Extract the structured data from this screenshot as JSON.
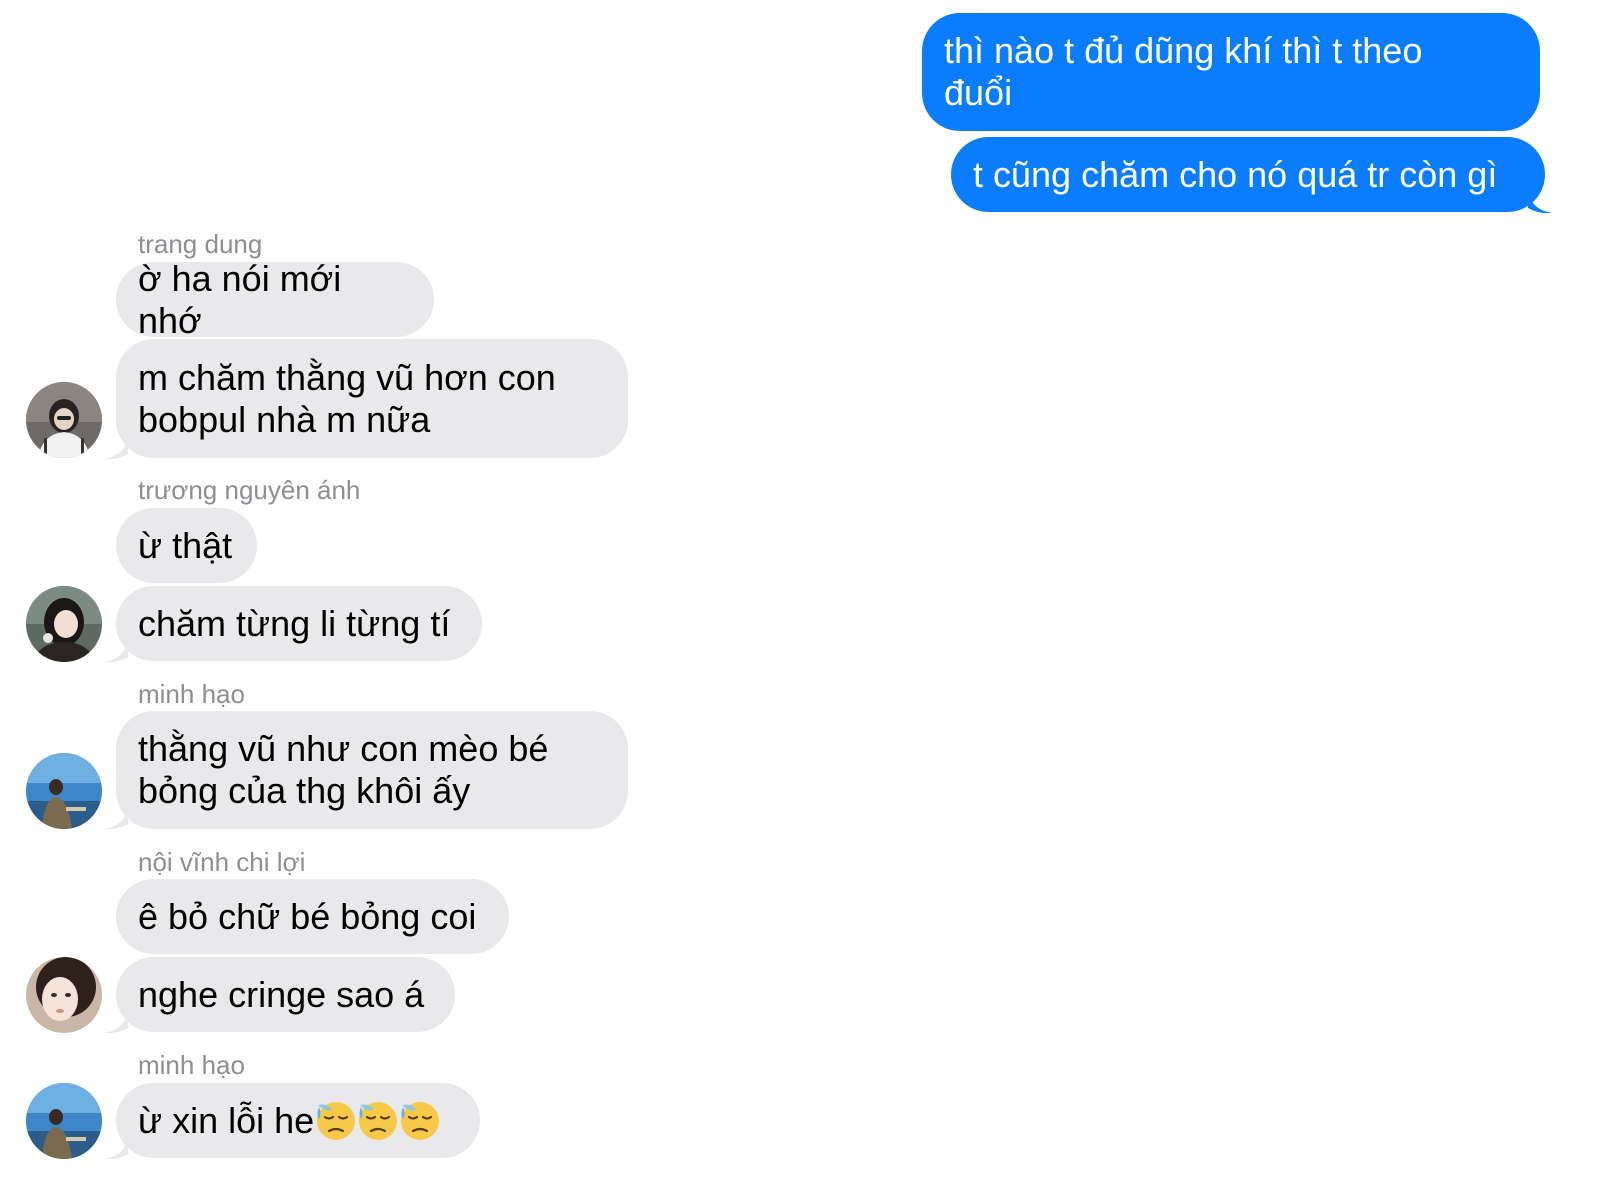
{
  "colors": {
    "outgoing_bubble": "#0a7cff",
    "incoming_bubble": "#e9e9eb",
    "sender_name": "#8e8e93"
  },
  "messages": {
    "out_1": "thì nào t đủ dũng khí thì t theo\nđuổi",
    "out_2": "t cũng chăm cho nó quá tr còn gì",
    "in_1": "ờ ha nói mới nhớ",
    "in_2": "m chăm thằng vũ hơn con\nbobpul nhà m nữa",
    "in_3": "ừ thật",
    "in_4": "chăm từng li từng tí",
    "in_5": "thằng vũ như con mèo bé\nbỏng của thg khôi ấy",
    "in_6": "ê bỏ chữ bé bỏng coi",
    "in_7": "nghe cringe sao á",
    "in_8": "ừ xin lỗi he"
  },
  "senders": {
    "s1": "trang dung",
    "s2": "trương nguyên ánh",
    "s3": "minh hạo",
    "s4": "nội vĩnh chi lợi",
    "s5": "minh hạo"
  },
  "icons": {
    "emoji": "downcast-face-with-sweat-emoji",
    "emoji_count": 3
  }
}
